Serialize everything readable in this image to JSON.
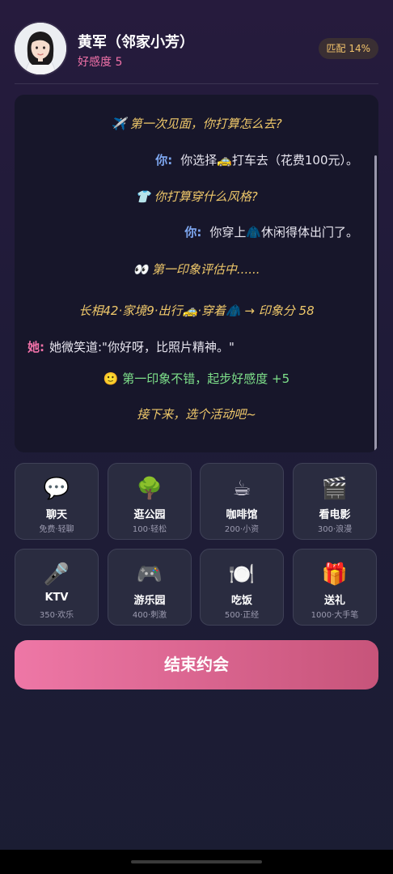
{
  "header": {
    "name": "黄军（邻家小芳）",
    "favor": "好感度 5",
    "match": "匹配 14%"
  },
  "story": [
    {
      "kind": "q",
      "text": "✈️ 第一次见面，你打算怎么去?"
    },
    {
      "kind": "you",
      "label": "你:",
      "text": "你选择🚕打车去（花费100元）。"
    },
    {
      "kind": "q",
      "text": "👕 你打算穿什么风格?"
    },
    {
      "kind": "you",
      "label": "你:",
      "text": "你穿上🧥休闲得体出门了。"
    },
    {
      "kind": "q",
      "text": "👀 第一印象评估中......"
    },
    {
      "kind": "q",
      "text": "长相42·家境9·出行🚕·穿着🧥 → 印象分 58"
    },
    {
      "kind": "she",
      "label": "她:",
      "text": "她微笑道:\"你好呀，比照片精神。\""
    },
    {
      "kind": "green",
      "text": "🙂 第一印象不错，起步好感度 +5"
    },
    {
      "kind": "q",
      "text": "接下来，选个活动吧~"
    }
  ],
  "activities": [
    {
      "icon": "speech-bubble-icon",
      "emoji": "💬",
      "name": "聊天",
      "sub": "免费·轻聊"
    },
    {
      "icon": "tree-icon",
      "emoji": "🌳",
      "name": "逛公园",
      "sub": "100·轻松"
    },
    {
      "icon": "coffee-icon",
      "emoji": "☕",
      "name": "咖啡馆",
      "sub": "200·小资"
    },
    {
      "icon": "clapperboard-icon",
      "emoji": "🎬",
      "name": "看电影",
      "sub": "300·浪漫"
    },
    {
      "icon": "microphone-icon",
      "emoji": "🎤",
      "name": "KTV",
      "sub": "350·欢乐"
    },
    {
      "icon": "gamepad-icon",
      "emoji": "🎮",
      "name": "游乐园",
      "sub": "400·刺激"
    },
    {
      "icon": "plate-icon",
      "emoji": "🍽️",
      "name": "吃饭",
      "sub": "500·正经"
    },
    {
      "icon": "gift-icon",
      "emoji": "🎁",
      "name": "送礼",
      "sub": "1000·大手笔"
    }
  ],
  "end_button": "结束约会",
  "colors": {
    "accent_pink": "#f071a8",
    "question_gold": "#efc86a",
    "you_blue": "#7ea7f0",
    "success_green": "#7ee08a"
  }
}
